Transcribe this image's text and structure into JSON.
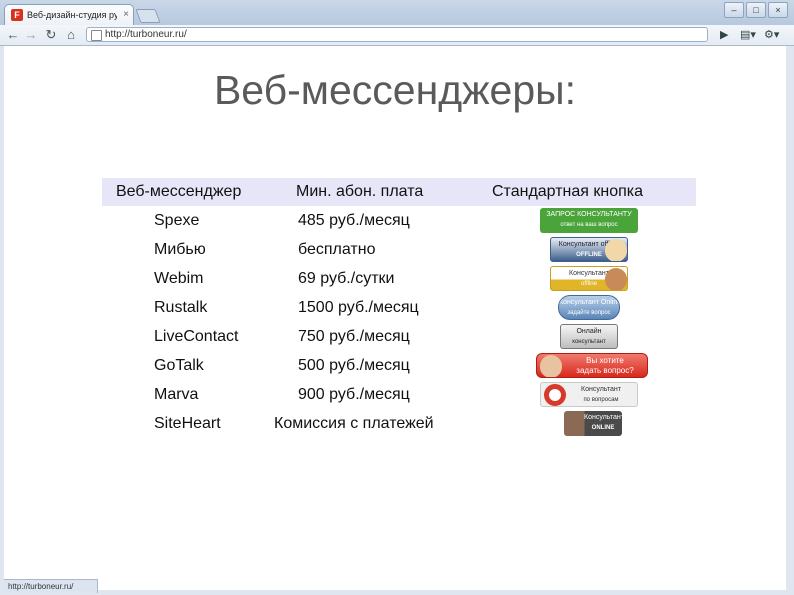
{
  "browser": {
    "tab": {
      "favicon_letter": "F",
      "title": "Веб-дизайн-студия ручной работы",
      "close_glyph": "×"
    },
    "window_buttons": [
      "–",
      "□",
      "×"
    ],
    "url": "http://turboneur.ru/",
    "nav": {
      "back": "←",
      "forward": "→",
      "reload": "↻",
      "home": "⌂"
    },
    "toolbar_right": {
      "go": "▶",
      "page_menu": "▤▾",
      "tools_menu": "⚙▾"
    },
    "status_url": "http://turboneur.ru/"
  },
  "slide": {
    "title": "Веб-мессенджеры:",
    "table": {
      "headers": [
        "Веб-мессенджер",
        "Мин. абон. плата",
        "Стандартная кнопка"
      ],
      "rows": [
        {
          "name": "Spexe",
          "price": "485  руб./месяц",
          "badge": {
            "line1": "ЗАПРОС КОНСУЛЬТАНТУ",
            "line2": "ответ на ваш вопрос",
            "color": "#4aa43a"
          }
        },
        {
          "name": "Мибью",
          "price": "бесплатно",
          "badge": {
            "line1": "Консультант offline",
            "line2": "OFFLINE",
            "color": "#3d5f8c"
          }
        },
        {
          "name": "Webim",
          "price": "69 руб./сутки",
          "badge": {
            "line1": "Консультант",
            "line2": "offline",
            "color": "#e0b52a"
          }
        },
        {
          "name": "Rustalk",
          "price": "1500 руб./месяц",
          "badge": {
            "line1": "Консультант Online",
            "line2": "задайте вопрос",
            "color": "#5a85b8"
          }
        },
        {
          "name": "LiveContact",
          "price": "750  руб./месяц",
          "badge": {
            "line1": "Онлайн",
            "line2": "консультант",
            "color": "#9a9a9a"
          }
        },
        {
          "name": "GoTalk",
          "price": "500 руб./месяц",
          "badge": {
            "line1": "Вы хотите",
            "line2": "задать вопрос?",
            "color": "#e03a2e"
          }
        },
        {
          "name": "Marva",
          "price": "900 руб./месяц",
          "badge": {
            "line1": "Консультант",
            "line2": "по вопросам",
            "color": "#f0f0f0"
          }
        },
        {
          "name": "SiteHeart",
          "price": "Комиссия с платежей",
          "badge": {
            "line1": "Консультант",
            "line2": "ONLINE",
            "color": "#4a4a4a"
          }
        }
      ]
    }
  }
}
